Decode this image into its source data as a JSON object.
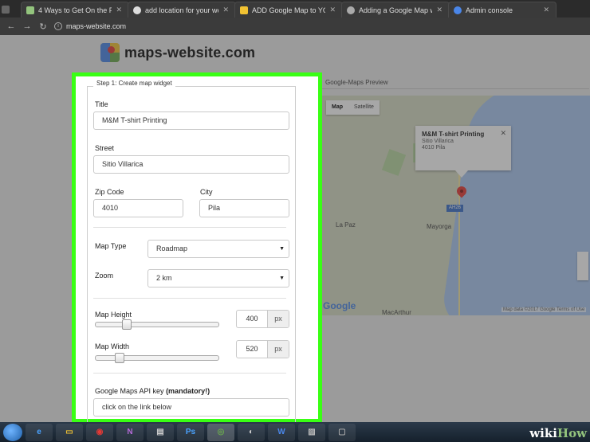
{
  "browser": {
    "tabs": [
      {
        "label": "",
        "color": "#888888"
      },
      {
        "label": "4 Ways to Get On the F",
        "color": "#93c47d"
      },
      {
        "label": "add location for your we",
        "color": "#dddddd"
      },
      {
        "label": "ADD Google Map to YO",
        "color": "#f1c232"
      },
      {
        "label": "Adding a Google Map w",
        "color": "#aaaaaa"
      },
      {
        "label": "Admin console",
        "color": "#4a86e8"
      }
    ],
    "url": "maps-website.com"
  },
  "site": {
    "title": "maps-website.com"
  },
  "form": {
    "legend": "Step 1: Create map widget",
    "title_label": "Title",
    "title_value": "M&M T-shirt Printing",
    "street_label": "Street",
    "street_value": "Sitio Villarica",
    "zip_label": "Zip Code",
    "zip_value": "4010",
    "city_label": "City",
    "city_value": "Pila",
    "maptype_label": "Map Type",
    "maptype_value": "Roadmap",
    "zoom_label": "Zoom",
    "zoom_value": "2 km",
    "height_label": "Map Height",
    "height_value": "400",
    "height_fraction": 0.23,
    "width_label": "Map Width",
    "width_value": "520",
    "width_fraction": 0.17,
    "unit": "px",
    "apikey_label": "Google Maps API key",
    "apikey_mandatory": "(mandatory!)",
    "apikey_value": "click on the link below"
  },
  "preview": {
    "label": "Google-Maps Preview",
    "map_btn": "Map",
    "satellite_btn": "Satellite",
    "info_title": "M&M T-shirt Printing",
    "info_line1": "Sitio Villarica",
    "info_line2": "4010 Pila",
    "place1": "La Paz",
    "place2": "Mayorga",
    "place3": "MacArthur",
    "highway": "AH26",
    "attribution": "Map data ©2017 Google    Terms of Use",
    "google": "Google"
  },
  "watermark": {
    "wiki": "wiki",
    "how": "How"
  }
}
